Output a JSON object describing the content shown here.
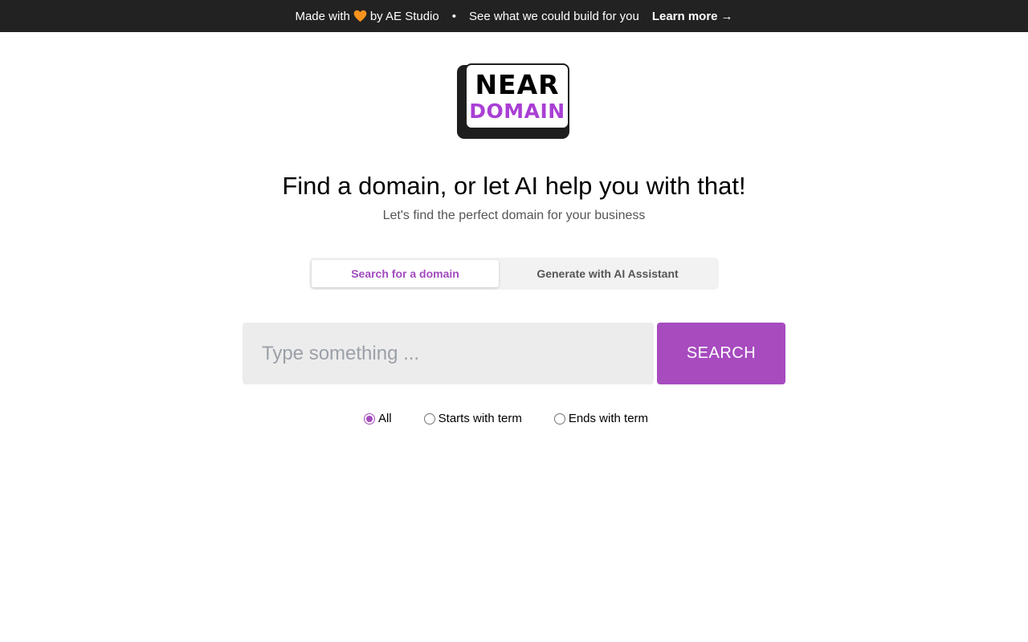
{
  "banner": {
    "made_with": "Made with",
    "by": "by AE Studio",
    "separator": "•",
    "pitch": "See what we could build for you",
    "learn_more": "Learn more",
    "arrow": "→"
  },
  "logo": {
    "line1": "NEAR",
    "line2": "DOMAIN"
  },
  "hero": {
    "title": "Find a domain, or let AI help you with that!",
    "subtitle": "Let's find the perfect domain for your business"
  },
  "tabs": [
    {
      "label": "Search for a domain",
      "active": true
    },
    {
      "label": "Generate with AI Assistant",
      "active": false
    }
  ],
  "search": {
    "placeholder": "Type something ...",
    "value": "",
    "button_label": "SEARCH"
  },
  "filters": [
    {
      "label": "All",
      "checked": true
    },
    {
      "label": "Starts with term",
      "checked": false
    },
    {
      "label": "Ends with term",
      "checked": false
    }
  ],
  "colors": {
    "accent": "#a74bbf",
    "banner_bg": "#222222",
    "heart": "#f7931e"
  }
}
